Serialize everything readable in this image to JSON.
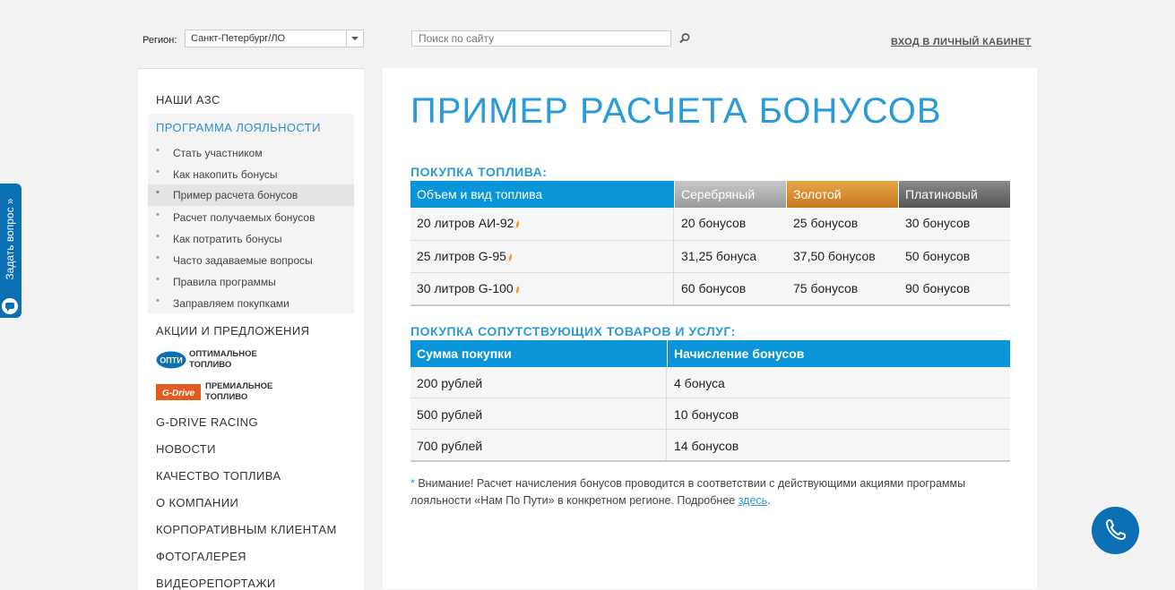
{
  "header": {
    "region_label": "Регион:",
    "region_value": "Санкт-Петербург/ЛО",
    "search_placeholder": "Поиск по сайту",
    "login_link": "ВХОД В ЛИЧНЫЙ КАБИНЕТ"
  },
  "sidebar": {
    "stations": "НАШИ АЗС",
    "loyalty": {
      "title": "ПРОГРАММА ЛОЯЛЬНОСТИ",
      "items": [
        {
          "label": "Стать участником"
        },
        {
          "label": "Как накопить бонусы"
        },
        {
          "label": "Пример расчета бонусов"
        },
        {
          "label": "Расчет получаемых бонусов"
        },
        {
          "label": "Как потратить бонусы"
        },
        {
          "label": "Часто задаваемые вопросы"
        },
        {
          "label": "Правила программы"
        },
        {
          "label": "Заправляем покупками"
        }
      ]
    },
    "promos": "АКЦИИ И ПРЕДЛОЖЕНИЯ",
    "brands": [
      {
        "logo_text": "ОПТИ",
        "line1": "ОПТИМАЛЬНОЕ",
        "line2": "ТОПЛИВО"
      },
      {
        "logo_text": "G-Drive",
        "line1": "ПРЕМИАЛЬНОЕ",
        "line2": "ТОПЛИВО"
      }
    ],
    "items_after": [
      "G-DRIVE RACING",
      "НОВОСТИ",
      "КАЧЕСТВО ТОПЛИВА",
      "О КОМПАНИИ",
      "КОРПОРАТИВНЫМ КЛИЕНТАМ",
      "ФОТОГАЛЕРЕЯ",
      "ВИДЕОРЕПОРТАЖИ"
    ]
  },
  "main": {
    "title": "ПРИМЕР РАСЧЕТА БОНУСОВ",
    "fuel_section": {
      "title": "ПОКУПКА ТОПЛИВА:",
      "headers": [
        "Объем и вид топлива",
        "Серебряный",
        "Золотой",
        "Платиновый"
      ],
      "rows": [
        [
          "20 литров АИ-92",
          "20 бонусов",
          "25 бонусов",
          "30 бонусов"
        ],
        [
          "25 литров G-95",
          "31,25 бонуса",
          "37,50 бонусов",
          "50 бонусов"
        ],
        [
          "30 литров G-100",
          "60 бонусов",
          "75 бонусов",
          "90 бонусов"
        ]
      ]
    },
    "goods_section": {
      "title": "ПОКУПКА СОПУТСТВУЮЩИХ ТОВАРОВ И УСЛУГ:",
      "headers": [
        "Сумма покупки",
        "Начисление бонусов"
      ],
      "rows": [
        [
          "200 рублей",
          "4 бонуса"
        ],
        [
          "500 рублей",
          "10 бонусов"
        ],
        [
          "700 рублей",
          "14 бонусов"
        ]
      ]
    },
    "note": {
      "star": "*",
      "text": " Внимание! Расчет начисления бонусов проводится в соответствии с действующими акциями программы лояльности «Нам По Пути» в конкретном регионе. Подробнее ",
      "link": "здесь",
      "end": "."
    }
  },
  "widgets": {
    "ask_label": "Задать вопрос »"
  },
  "colors": {
    "accent": "#2a9ad8",
    "header_blue": "#0a95d9",
    "silver": "#9a9a9a",
    "gold": "#c8781a",
    "platinum": "#555555"
  }
}
